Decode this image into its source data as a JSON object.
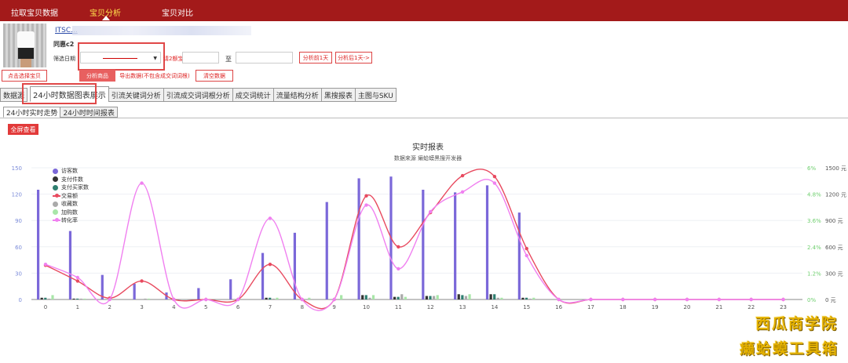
{
  "topnav": {
    "items": [
      {
        "label": "拉取宝贝数据",
        "active": false
      },
      {
        "label": "宝贝分析",
        "active": true
      },
      {
        "label": "宝贝对比",
        "active": false
      }
    ]
  },
  "product": {
    "title": "ITSC...",
    "shop": "同惠c2",
    "date_label": "筛选日期",
    "date_hint": "请2额宝数据量",
    "to_label": "至",
    "prev_day": "分析前1天",
    "next_day": "分析后1天->"
  },
  "actions": {
    "select_product": "点击选择宝贝",
    "analyze": "分析商品",
    "export": "导出数据(不包含成交词词根)",
    "clear": "清空数据"
  },
  "tabs": [
    "数据源",
    "24小时数据图表展示",
    "引流关键词分析",
    "引流成交词词根分析",
    "成交词统计",
    "流量结构分析",
    "黑搜报表",
    "主图与SKU"
  ],
  "subtabs": [
    "24小时实时走势",
    "24小时时间报表"
  ],
  "fullscreen": "全屏查看",
  "watermark": {
    "line1": "西瓜商学院",
    "line2": "癞蛤蟆工具箱"
  },
  "chart_data": {
    "type": "bar",
    "title": "实时报表",
    "subtitle": "数据来源 癞蛤蟆黑搜开发器",
    "categories": [
      "0",
      "1",
      "2",
      "3",
      "4",
      "5",
      "6",
      "7",
      "8",
      "9",
      "10",
      "11",
      "12",
      "13",
      "14",
      "15",
      "16",
      "17",
      "18",
      "19",
      "20",
      "21",
      "22",
      "23"
    ],
    "y_left": {
      "ticks": [
        "0",
        "30",
        "60",
        "90",
        "120",
        "150"
      ],
      "range": [
        0,
        150
      ]
    },
    "y_rate": {
      "ticks": [
        "0%",
        "1.2%",
        "2.4%",
        "3.6%",
        "4.8%",
        "6%"
      ],
      "range": [
        0,
        6
      ]
    },
    "y_money": {
      "ticks": [
        "0 元",
        "300 元",
        "600 元",
        "900 元",
        "1200 元",
        "1500 元"
      ],
      "range": [
        0,
        1500
      ]
    },
    "legend": [
      "访客数",
      "支付件数",
      "支付买家数",
      "交易额",
      "收藏数",
      "加购数",
      "转化率"
    ],
    "colors": {
      "访客数": "#7b68d9",
      "支付件数": "#333333",
      "支付买家数": "#2f7f70",
      "交易额": "#e84a5f",
      "收藏数": "#aaaaaa",
      "加购数": "#a8e6a8",
      "转化率": "#f080f0"
    },
    "series": [
      {
        "name": "访客数",
        "axis": "left",
        "kind": "bar",
        "values": [
          125,
          78,
          28,
          18,
          8,
          13,
          23,
          53,
          76,
          111,
          138,
          140,
          125,
          122,
          130,
          99,
          0,
          0,
          0,
          0,
          0,
          0,
          0,
          0
        ]
      },
      {
        "name": "支付件数",
        "axis": "left",
        "kind": "bar",
        "values": [
          2,
          1,
          0,
          0,
          0,
          0,
          0,
          2,
          0,
          0,
          5,
          3,
          4,
          6,
          6,
          2,
          0,
          0,
          0,
          0,
          0,
          0,
          0,
          0
        ]
      },
      {
        "name": "支付买家数",
        "axis": "left",
        "kind": "bar",
        "values": [
          2,
          1,
          0,
          0,
          0,
          0,
          0,
          2,
          0,
          0,
          5,
          3,
          4,
          5,
          6,
          2,
          0,
          0,
          0,
          0,
          0,
          0,
          0,
          0
        ]
      },
      {
        "name": "收藏数",
        "axis": "left",
        "kind": "bar",
        "values": [
          1,
          1,
          0,
          1,
          0,
          0,
          0,
          1,
          0,
          0,
          2,
          6,
          4,
          4,
          2,
          1,
          0,
          0,
          0,
          0,
          0,
          0,
          0,
          0
        ]
      },
      {
        "name": "加购数",
        "axis": "left",
        "kind": "bar",
        "values": [
          5,
          1,
          0,
          1,
          0,
          0,
          0,
          2,
          2,
          5,
          5,
          3,
          5,
          6,
          2,
          2,
          0,
          0,
          0,
          0,
          0,
          0,
          0,
          0
        ]
      },
      {
        "name": "交易额",
        "axis": "money",
        "kind": "line",
        "values": [
          390,
          210,
          15,
          210,
          0,
          0,
          0,
          400,
          0,
          0,
          1180,
          600,
          990,
          1410,
          1400,
          580,
          0,
          0,
          0,
          0,
          0,
          0,
          0,
          0
        ]
      },
      {
        "name": "转化率",
        "axis": "rate",
        "kind": "line",
        "values": [
          1.6,
          1.0,
          0.0,
          5.3,
          0.0,
          0.0,
          0.0,
          3.7,
          0.0,
          0.0,
          4.3,
          1.4,
          4.0,
          4.9,
          5.3,
          2.0,
          0.0,
          0.0,
          0.0,
          0.0,
          0.0,
          0.0,
          0.0,
          0.0
        ]
      }
    ]
  }
}
